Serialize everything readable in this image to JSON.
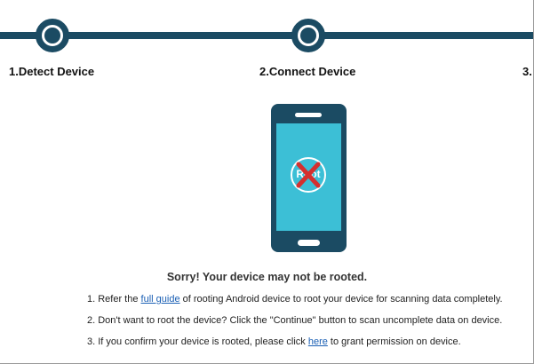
{
  "steps": [
    {
      "label": "1.Detect Device"
    },
    {
      "label": "2.Connect Device"
    },
    {
      "label": "3."
    }
  ],
  "phone": {
    "badge_text": "Root",
    "badge_mark": "red-x-icon"
  },
  "message": {
    "title": "Sorry! Your device may not be rooted."
  },
  "instructions": {
    "line1": {
      "prefix": "1. Refer the ",
      "link": "full guide",
      "suffix": " of rooting Android device to root your device for scanning data completely."
    },
    "line2": {
      "text": "2. Don't want to root the device? Click the \"Continue\" button to scan uncomplete data on device."
    },
    "line3": {
      "prefix": "3. If you confirm your device is rooted, please click ",
      "link": "here",
      "suffix": " to grant permission on device."
    }
  },
  "colors": {
    "accent": "#1b4b63",
    "screen": "#3cbfd6",
    "error": "#d4302f",
    "link": "#1a5fb4"
  }
}
